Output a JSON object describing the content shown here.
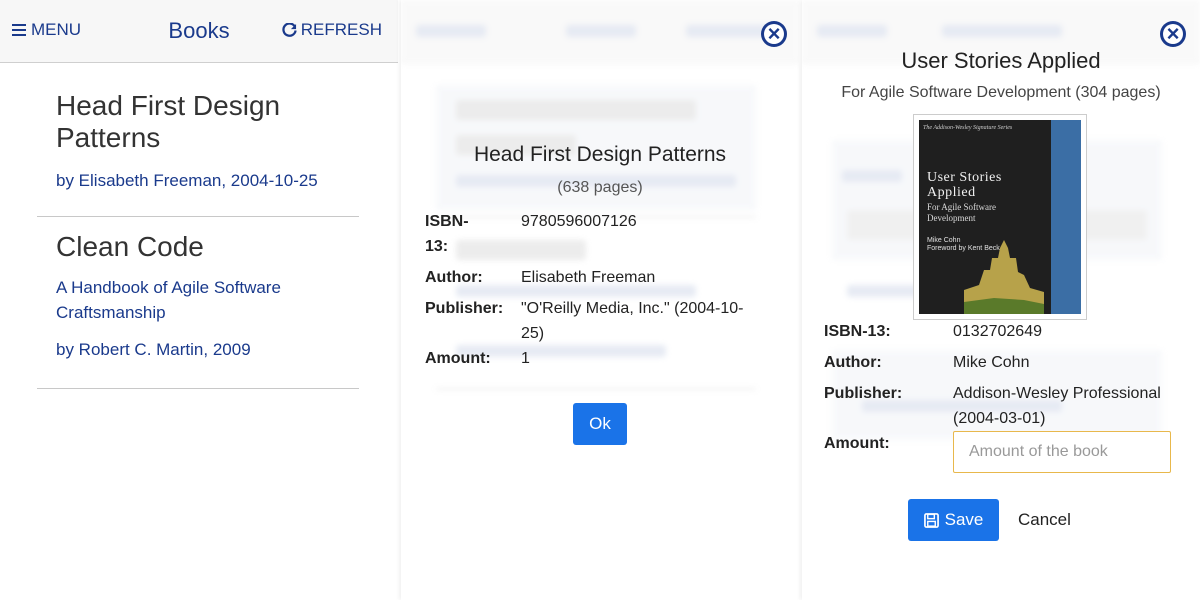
{
  "list_screen": {
    "menu_label": "MENU",
    "title": "Books",
    "refresh_label": "REFRESH",
    "books": [
      {
        "title": "Head First Design Patterns",
        "subtitle": "",
        "byline": "by Elisabeth Freeman, 2004-10-25"
      },
      {
        "title": "Clean Code",
        "subtitle": "A Handbook of Agile Software Craftsmanship",
        "byline": "by Robert C. Martin, 2009"
      }
    ]
  },
  "detail_dialog": {
    "title": "Head First Design Patterns",
    "pages": "(638 pages)",
    "fields": [
      {
        "label": "ISBN-13:",
        "value": "9780596007126"
      },
      {
        "label": "Author:",
        "value": "Elisabeth Freeman"
      },
      {
        "label": "Publisher:",
        "value": "\"O'Reilly Media, Inc.\" (2004-10-25)"
      },
      {
        "label": "Amount:",
        "value": "1"
      }
    ],
    "ok_label": "Ok"
  },
  "add_dialog": {
    "title": "User Stories Applied",
    "subtitle": "For Agile Software Development (304 pages)",
    "cover": {
      "series": "The Addison-Wesley Signature Series",
      "title_line1": "User Stories",
      "title_line2": "Applied",
      "subtitle_line1": "For Agile Software",
      "subtitle_line2": "Development",
      "author": "Mike Cohn",
      "foreword": "Foreword by Kent Beck"
    },
    "fields": [
      {
        "label": "ISBN-13:",
        "value": "0132702649"
      },
      {
        "label": "Author:",
        "value": "Mike Cohn"
      },
      {
        "label": "Publisher:",
        "value": "Addison-Wesley Professional (2004-03-01)"
      }
    ],
    "amount_label": "Amount:",
    "amount_placeholder": "Amount of the book",
    "save_label": "Save",
    "cancel_label": "Cancel"
  },
  "colors": {
    "primary": "#1a3a8c",
    "button": "#1a73e8",
    "input_border": "#e8b84c"
  }
}
